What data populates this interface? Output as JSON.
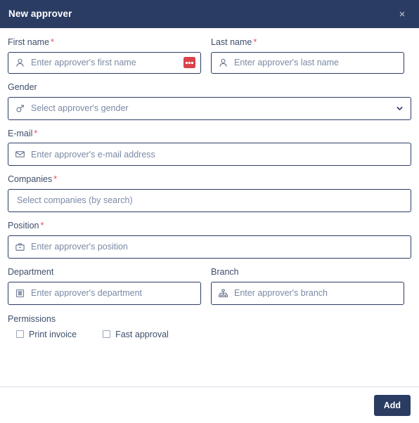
{
  "dialog": {
    "title": "New approver",
    "close_label": "×"
  },
  "colors": {
    "header_bg": "#2b3c63",
    "accent": "#2b3c63",
    "required_asterisk": "#e8485b",
    "badge_red": "#d9434a",
    "label_text": "#3f4f6b",
    "placeholder_text": "#7b8aa5",
    "border": "#2b3c63"
  },
  "form": {
    "first_name": {
      "label": "First name",
      "required": "*",
      "placeholder": "Enter approver's first name",
      "value": "",
      "icon": "user-icon",
      "badge": "ellipsis-badge-icon"
    },
    "last_name": {
      "label": "Last name",
      "required": "*",
      "placeholder": "Enter approver's last name",
      "value": "",
      "icon": "user-icon"
    },
    "gender": {
      "label": "Gender",
      "required": "",
      "placeholder": "Select approver's gender",
      "value": "",
      "icon": "gender-icon",
      "chevron": "chevron-down-icon"
    },
    "email": {
      "label": "E-mail",
      "required": "*",
      "placeholder": "Enter approver's e-mail address",
      "value": "",
      "icon": "envelope-icon"
    },
    "companies": {
      "label": "Companies",
      "required": "*",
      "placeholder": "Select companies (by search)",
      "value": "",
      "icon": ""
    },
    "position": {
      "label": "Position",
      "required": "*",
      "placeholder": "Enter approver's position",
      "value": "",
      "icon": "briefcase-icon"
    },
    "department": {
      "label": "Department",
      "required": "",
      "placeholder": "Enter approver's department",
      "value": "",
      "icon": "building-icon"
    },
    "branch": {
      "label": "Branch",
      "required": "",
      "placeholder": "Enter approver's branch",
      "value": "",
      "icon": "sitemap-icon"
    },
    "permissions": {
      "label": "Permissions",
      "options": [
        {
          "label": "Print invoice",
          "checked": false
        },
        {
          "label": "Fast approval",
          "checked": false
        }
      ]
    }
  },
  "footer": {
    "add_label": "Add"
  }
}
